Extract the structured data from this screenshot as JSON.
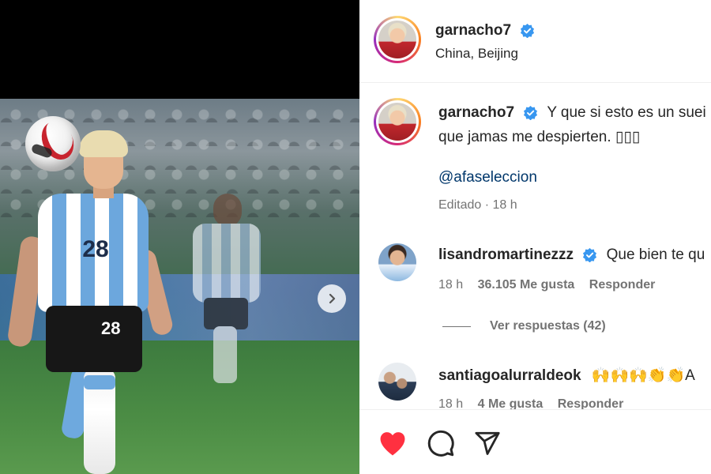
{
  "post": {
    "author": "garnacho7",
    "location": "China, Beijing",
    "jersey_number": "28",
    "caption": {
      "username": "garnacho7",
      "text": "Y que si esto es un sueño que jamas me despierten. 🇦🇷🇲🇴❤️",
      "line1": "Y que si esto es un suei",
      "line2": "que jamas me despierten. ▯▯▯",
      "mention": "@afaseleccion",
      "edited": "Editado · 18 h"
    }
  },
  "comments": [
    {
      "username": "lisandromartinezzz",
      "text": "Que bien te qu",
      "time": "18 h",
      "likes": "36.105 Me gusta",
      "reply": "Responder",
      "view_replies": "Ver respuestas (42)",
      "verified": true
    },
    {
      "username": "santiagoalurraldeok",
      "text": "🙌🙌🙌👏👏A",
      "time": "18 h",
      "likes": "4 Me gusta",
      "reply": "Responder",
      "verified": false
    }
  ],
  "icons": {
    "verified": "verified-badge-icon",
    "next": "chevron-right-icon",
    "like": "heart-icon",
    "comment": "comment-icon",
    "share": "share-icon"
  },
  "colors": {
    "verified": "#3897f0",
    "like": "#ff3040",
    "mention": "#00376b",
    "muted": "#737373"
  }
}
